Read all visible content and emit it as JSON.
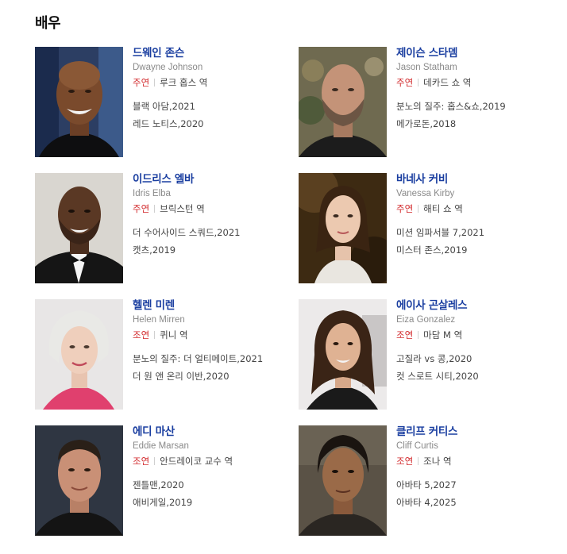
{
  "section_title": "배우",
  "actors": [
    {
      "name": "드웨인 존슨",
      "english_name": "Dwayne Johnson",
      "role_type": "주연",
      "role": "루크 홉스 역",
      "works": [
        "블랙 아담,2021",
        "레드 노티스,2020"
      ]
    },
    {
      "name": "제이슨 스타뎀",
      "english_name": "Jason Statham",
      "role_type": "주연",
      "role": "데카드 쇼 역",
      "works": [
        "분노의 질주: 홉스&쇼,2019",
        "메가로돈,2018"
      ]
    },
    {
      "name": "이드리스 엘바",
      "english_name": "Idris Elba",
      "role_type": "주연",
      "role": "브릭스턴 역",
      "works": [
        "더 수어사이드 스쿼드,2021",
        "캣츠,2019"
      ]
    },
    {
      "name": "바네사 커비",
      "english_name": "Vanessa Kirby",
      "role_type": "주연",
      "role": "해티 쇼 역",
      "works": [
        "미션 임파서블 7,2021",
        "미스터 존스,2019"
      ]
    },
    {
      "name": "헬렌 미렌",
      "english_name": "Helen Mirren",
      "role_type": "조연",
      "role": "퀴니 역",
      "works": [
        "분노의 질주: 더 얼티메이트,2021",
        "더 원 앤 온리 이반,2020"
      ]
    },
    {
      "name": "에이사 곤살레스",
      "english_name": "Eiza Gonzalez",
      "role_type": "조연",
      "role": "마담 M 역",
      "works": [
        "고질라 vs 콩,2020",
        "컷 스로트 시티,2020"
      ]
    },
    {
      "name": "에디 마산",
      "english_name": "Eddie Marsan",
      "role_type": "조연",
      "role": "안드레이코 교수 역",
      "works": [
        "젠틀맨,2020",
        "애비게일,2019"
      ]
    },
    {
      "name": "클리프 커티스",
      "english_name": "Cliff Curtis",
      "role_type": "조연",
      "role": "조나 역",
      "works": [
        "아바타 5,2027",
        "아바타 4,2025"
      ]
    }
  ]
}
